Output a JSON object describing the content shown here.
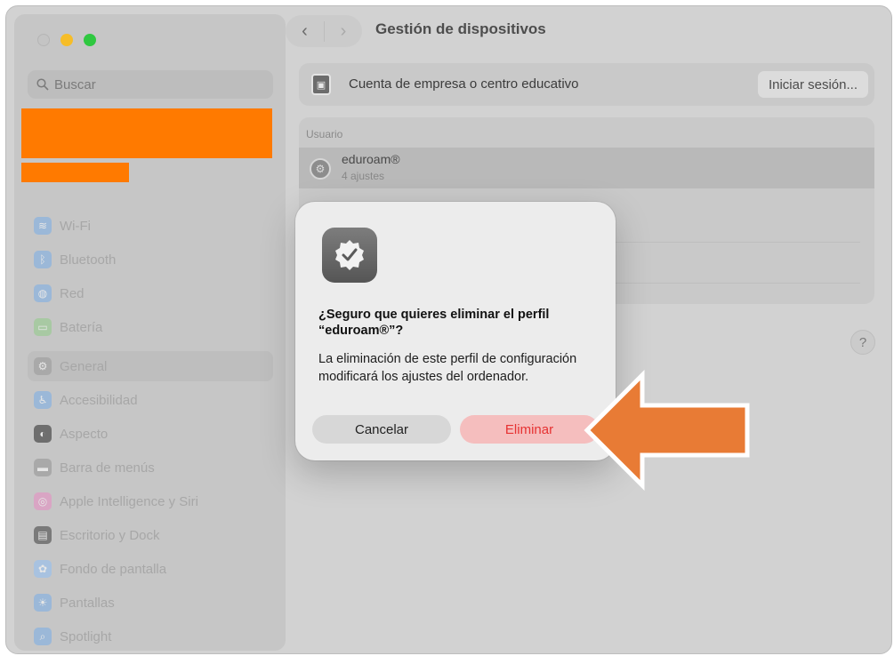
{
  "window": {
    "title": "Gestión de dispositivos"
  },
  "sidebar": {
    "search_placeholder": "Buscar",
    "items": [
      {
        "label": "Wi-Fi",
        "icon": "wifi-icon",
        "color": "#9bb8d8"
      },
      {
        "label": "Bluetooth",
        "icon": "bluetooth-icon",
        "color": "#9bb8d8"
      },
      {
        "label": "Red",
        "icon": "globe-icon",
        "color": "#9bb8d8"
      },
      {
        "label": "Batería",
        "icon": "battery-icon",
        "color": "#a8c9a3"
      },
      {
        "label": "General",
        "icon": "gear-icon",
        "color": "#a9a9a9",
        "selected": true
      },
      {
        "label": "Accesibilidad",
        "icon": "accessibility-icon",
        "color": "#9bb8d8"
      },
      {
        "label": "Aspecto",
        "icon": "appearance-icon",
        "color": "#6e6e6e"
      },
      {
        "label": "Barra de menús",
        "icon": "menubar-icon",
        "color": "#a9a9a9"
      },
      {
        "label": "Apple Intelligence y Siri",
        "icon": "siri-icon",
        "color": "#d9a5c4"
      },
      {
        "label": "Escritorio y Dock",
        "icon": "dock-icon",
        "color": "#7a7a7a"
      },
      {
        "label": "Fondo de pantalla",
        "icon": "wallpaper-icon",
        "color": "#a8c2e0"
      },
      {
        "label": "Pantallas",
        "icon": "display-icon",
        "color": "#9bb8d8"
      },
      {
        "label": "Spotlight",
        "icon": "spotlight-icon",
        "color": "#9bb8d8"
      }
    ]
  },
  "content": {
    "account_label": "Cuenta de empresa o centro educativo",
    "signin_button": "Iniciar sesión...",
    "user_section": "Usuario",
    "profile_name": "eduroam®",
    "profile_sub": "4 ajustes",
    "help": "?"
  },
  "dialog": {
    "title": "¿Seguro que quieres eliminar el perfil “eduroam®”?",
    "body": "La eliminación de este perfil de configuración modificará los ajustes del ordenador.",
    "cancel": "Cancelar",
    "delete": "Eliminar"
  },
  "colors": {
    "accent_delete": "#e63232",
    "annotation_arrow": "#e87b35",
    "redaction": "#ff7a00"
  }
}
